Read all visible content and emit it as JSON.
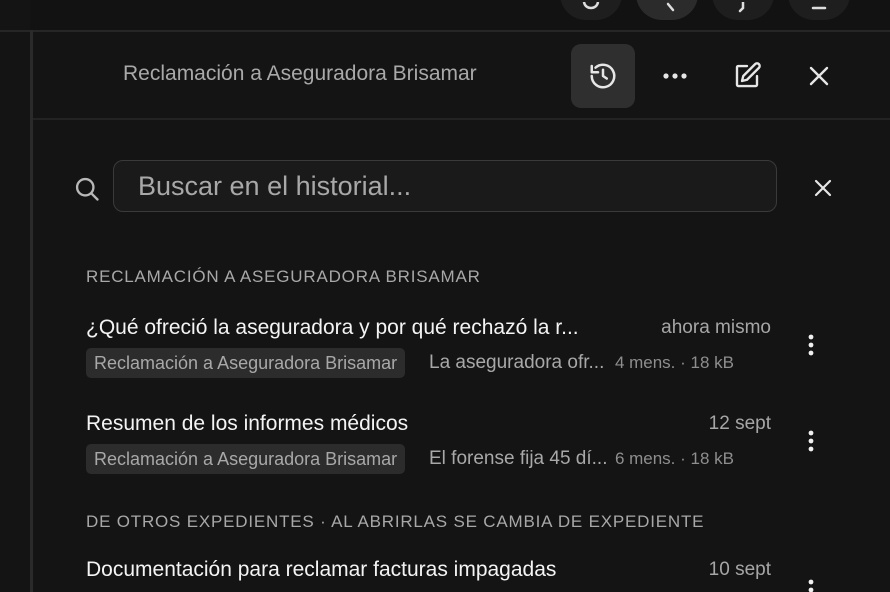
{
  "panel": {
    "title": "Reclamación a Aseguradora Brisamar"
  },
  "search": {
    "placeholder": "Buscar en el historial..."
  },
  "icons": {
    "history": "history-icon",
    "more": "more-horizontal-icon",
    "edit": "edit-icon",
    "close": "close-icon",
    "search": "search-icon",
    "clear": "clear-icon",
    "kebab": "more-vertical-icon"
  },
  "sections": [
    {
      "heading": "RECLAMACIÓN A ASEGURADORA BRISAMAR",
      "items": [
        {
          "title": "¿Qué ofreció la aseguradora y por qué rechazó la r...",
          "time": "ahora mismo",
          "tag": "Reclamación a Aseguradora Brisamar",
          "snippet": "La aseguradora ofr...",
          "counts": "4 mens. · 18 kB"
        },
        {
          "title": "Resumen de los informes médicos",
          "time": "12 sept",
          "tag": "Reclamación a Aseguradora Brisamar",
          "snippet": "El forense fija 45 dí...",
          "counts": "6 mens. · 18 kB"
        }
      ]
    },
    {
      "heading": "DE OTROS EXPEDIENTES · AL ABRIRLAS SE CAMBIA DE EXPEDIENTE",
      "items": [
        {
          "title": "Documentación para reclamar facturas impagadas",
          "time": "10 sept"
        }
      ]
    }
  ],
  "colors": {
    "background": "#121212",
    "panel": "#141414",
    "active_button": "#2f2f2f",
    "text_primary": "#f4f4f4",
    "text_secondary": "#a8a8a8"
  }
}
